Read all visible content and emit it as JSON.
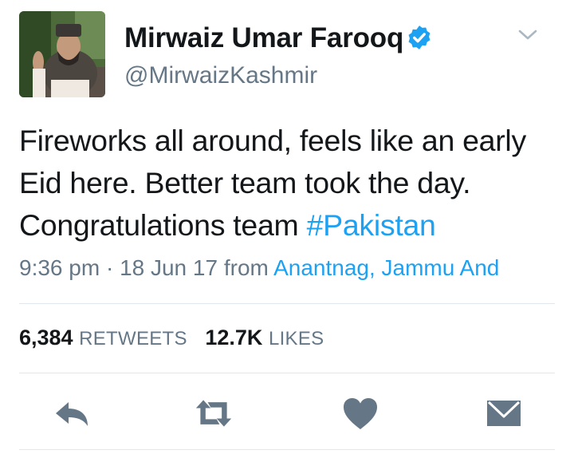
{
  "author": {
    "name": "Mirwaiz Umar Farooq",
    "handle": "@MirwaizKashmir",
    "verified": true
  },
  "tweet": {
    "text_before_hashtag": "Fireworks all around, feels like an early Eid here. Better team took the day. Congratulations team ",
    "hashtag": "#Pakistan"
  },
  "meta": {
    "time": "9:36 pm",
    "separator": "·",
    "date": "18 Jun 17",
    "from_label": "from",
    "location": "Anantnag, Jammu And"
  },
  "stats": {
    "retweets_count": "6,384",
    "retweets_label": "RETWEETS",
    "likes_count": "12.7K",
    "likes_label": "LIKES"
  },
  "icons": {
    "verified": "verified-badge-icon",
    "menu": "chevron-down-icon",
    "reply": "reply-icon",
    "retweet": "retweet-icon",
    "like": "heart-icon",
    "dm": "envelope-icon"
  },
  "colors": {
    "text": "#14171a",
    "secondary": "#657786",
    "link": "#1da1f2",
    "icon": "#657786",
    "divider": "#e1e8ed"
  }
}
